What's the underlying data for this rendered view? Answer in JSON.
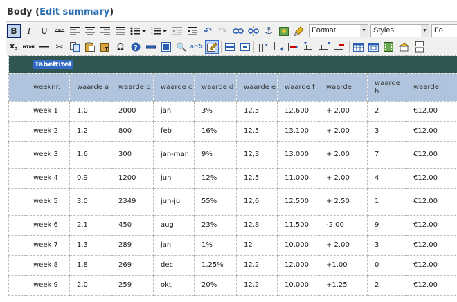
{
  "header": {
    "prefix": "Body (",
    "link": "Edit summary",
    "suffix": ")"
  },
  "toolbar": {
    "format_label": "Format",
    "styles_label": "Styles",
    "font_label": "Fo",
    "icons_row1": [
      "bold-icon",
      "italic-icon",
      "underline-icon",
      "strikethrough-icon",
      "align-left-icon",
      "align-center-icon",
      "align-right-icon",
      "align-justify-icon",
      "bullet-list-icon",
      "numbered-list-icon",
      "outdent-icon",
      "indent-icon",
      "undo-icon",
      "redo-icon",
      "link-icon",
      "unlink-icon",
      "anchor-icon",
      "image-icon",
      "cleanup-icon"
    ],
    "icons_row2": [
      "subscript-icon",
      "html-icon",
      "horizontal-rule-icon",
      "cut-icon",
      "copy-icon",
      "paste-icon",
      "paste-text-icon",
      "special-char-icon",
      "help-icon",
      "insert-layer-icon",
      "visual-aid-icon",
      "find-icon",
      "replace-icon",
      "edit-css-icon",
      "table-row-props-icon",
      "table-cell-props-icon",
      "row-before-icon",
      "row-after-icon",
      "delete-row-icon",
      "col-before-icon",
      "col-after-icon",
      "delete-col-icon",
      "table-icon",
      "table-props-icon",
      "media-icon",
      "template-icon"
    ]
  },
  "table": {
    "caption": "Tabeltitel",
    "headers": [
      "",
      "weeknr.",
      "waarde a",
      "waarde b",
      "waarde c",
      "waarde d",
      "waarde e",
      "waarde f",
      "waarde",
      "waarde h",
      "waarde i"
    ],
    "rows": [
      [
        "",
        "week 1",
        "1.0",
        "2000",
        "jan",
        "3%",
        "12,5",
        "12.600",
        "+ 2.00",
        "2",
        "€12.00"
      ],
      [
        "",
        "week 2",
        "1.2",
        "800",
        "feb",
        "16%",
        "12,5",
        "13.100",
        "+ 2.00",
        "3",
        "€12.00"
      ],
      [
        "",
        "week 3",
        "1.6",
        "300",
        "jan-mar",
        "9%",
        "12,3",
        "13.000",
        "+ 2.00",
        "7",
        "€12.00"
      ],
      [
        "",
        "week 4",
        "0.9",
        "1200",
        "jun",
        "12%",
        "12,5",
        "11.000",
        "+ 2.00",
        "4",
        "€12.00"
      ],
      [
        "",
        "week 5",
        "3.0",
        "2349",
        "jun-jul",
        "55%",
        "12,6",
        "12.500",
        "+ 2.50",
        "1",
        "€12.00"
      ],
      [
        "",
        "week 6",
        "2.1",
        "450",
        "aug",
        "23%",
        "12,8",
        "11.500",
        "-2.00",
        "9",
        "€12.00"
      ],
      [
        "",
        "week 7",
        "1.3",
        "289",
        "jan",
        "1%",
        "12",
        "10.000",
        "+ 2.00",
        "3",
        "€12.00"
      ],
      [
        "",
        "week 8",
        "1.8",
        "269",
        "dec",
        "1,25%",
        "12,2",
        "12.000",
        "+1.00",
        "0",
        "€12.00"
      ],
      [
        "",
        "week 9",
        "2.0",
        "259",
        "okt",
        "20%",
        "12,2",
        "10.000",
        "+1.25",
        "2",
        "€12.00"
      ]
    ]
  }
}
